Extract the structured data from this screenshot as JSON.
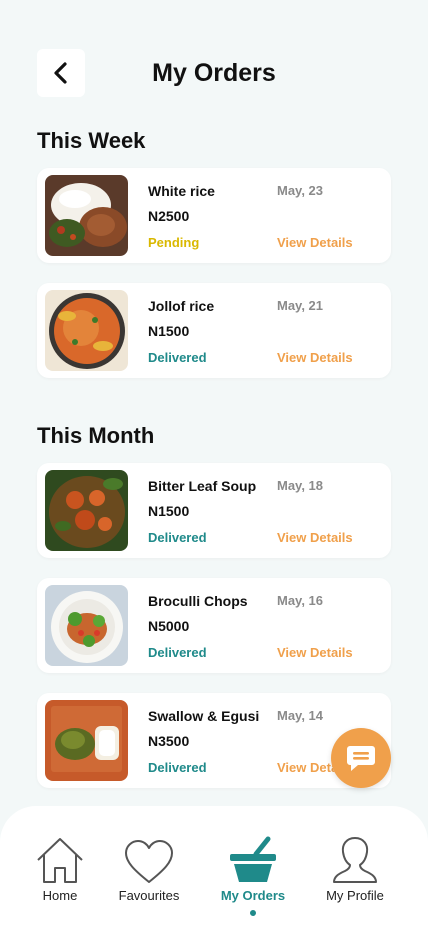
{
  "header": {
    "title": "My Orders"
  },
  "sections": [
    {
      "title": "This Week",
      "orders": [
        {
          "name": "White rice",
          "price": "N2500",
          "status": "Pending",
          "date": "May, 23",
          "action": "View Details"
        },
        {
          "name": "Jollof rice",
          "price": "N1500",
          "status": "Delivered",
          "date": "May, 21",
          "action": "View Details"
        }
      ]
    },
    {
      "title": "This Month",
      "orders": [
        {
          "name": "Bitter Leaf Soup",
          "price": "N1500",
          "status": "Delivered",
          "date": "May, 18",
          "action": "View Details"
        },
        {
          "name": "Broculli Chops",
          "price": "N5000",
          "status": "Delivered",
          "date": "May, 16",
          "action": "View Details"
        },
        {
          "name": "Swallow & Egusi",
          "price": "N3500",
          "status": "Delivered",
          "date": "May, 14",
          "action": "View Details"
        }
      ]
    }
  ],
  "nav": {
    "items": [
      {
        "label": "Home",
        "icon": "home-icon"
      },
      {
        "label": "Favourites",
        "icon": "heart-icon"
      },
      {
        "label": "My Orders",
        "icon": "basket-icon",
        "active": true
      },
      {
        "label": "My Profile",
        "icon": "profile-icon"
      }
    ]
  },
  "colors": {
    "accent": "#1f8a8a",
    "orange": "#f0a04b",
    "pending": "#d9b800",
    "background": "#f3f8f8"
  }
}
